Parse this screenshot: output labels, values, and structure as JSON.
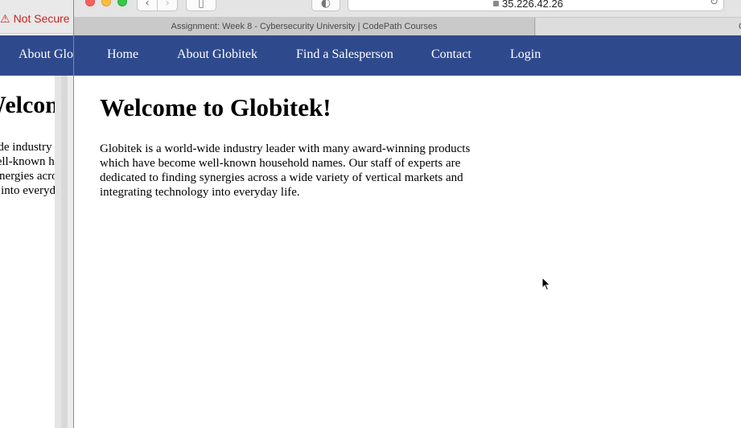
{
  "background_window": {
    "security_warning": "Not Secure",
    "nav_link": "About Globitek",
    "heading": "Welcome to Globitek!",
    "paragraph": "Globitek is a world-wide industry leader with many award-winning products which have become well-known household names. Our staff of experts are dedicated to finding synergies across a wide variety of vertical markets and integrating technology into everyday life."
  },
  "browser": {
    "address": "35.226.42.26",
    "active_tab_title": "Assignment: Week 8 - Cybersecurity University | CodePath Courses",
    "other_tab_title": "C",
    "icons": {
      "back": "chevron-left-icon",
      "forward": "chevron-right-icon",
      "sidebar": "sidebar-icon",
      "privacy": "privacy-report-icon",
      "lock": "lock-icon",
      "reload": "reload-icon"
    }
  },
  "site": {
    "nav": {
      "home": "Home",
      "about": "About Globitek",
      "find": "Find a Salesperson",
      "contact": "Contact",
      "login": "Login"
    },
    "heading": "Welcome to Globitek!",
    "paragraph": "Globitek is a world-wide industry leader with many award-winning products which have become well-known household names. Our staff of experts are dedicated to finding synergies across a wide variety of vertical markets and integrating technology into everyday life."
  },
  "colors": {
    "nav_background": "#2f4a8c",
    "warning_red": "#c6261e"
  }
}
